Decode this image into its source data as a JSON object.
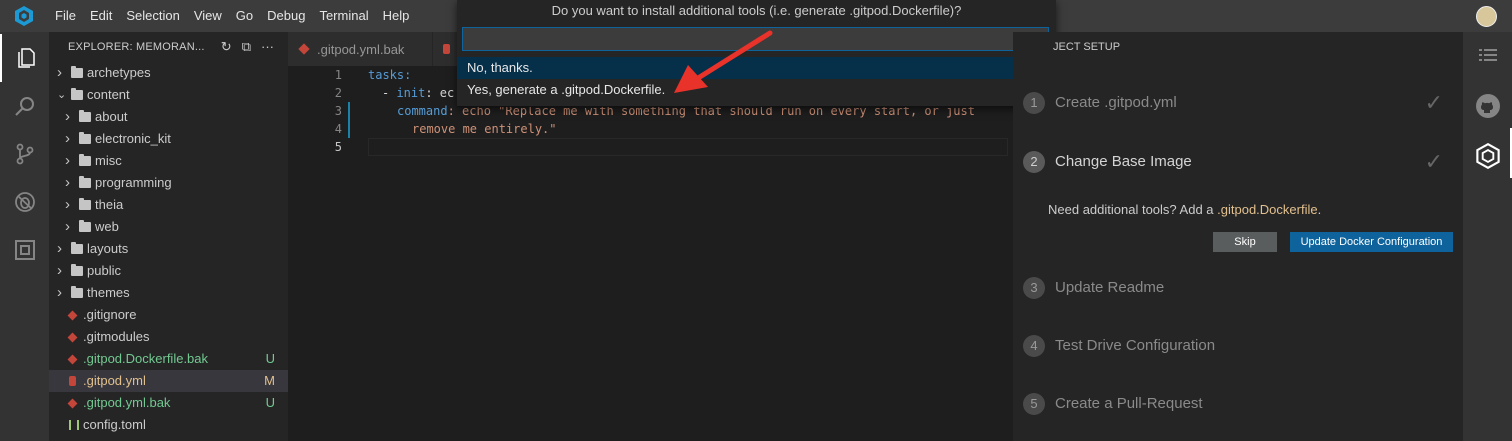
{
  "menubar": {
    "items": [
      "File",
      "Edit",
      "Selection",
      "View",
      "Go",
      "Debug",
      "Terminal",
      "Help"
    ]
  },
  "explorer": {
    "title": "EXPLORER: MEMORAN...",
    "tree": [
      {
        "label": "archetypes",
        "type": "folder",
        "expanded": false,
        "depth": 0
      },
      {
        "label": "content",
        "type": "folder",
        "expanded": true,
        "depth": 0
      },
      {
        "label": "about",
        "type": "folder",
        "expanded": false,
        "depth": 1
      },
      {
        "label": "electronic_kit",
        "type": "folder",
        "expanded": false,
        "depth": 1
      },
      {
        "label": "misc",
        "type": "folder",
        "expanded": false,
        "depth": 1
      },
      {
        "label": "programming",
        "type": "folder",
        "expanded": false,
        "depth": 1
      },
      {
        "label": "theia",
        "type": "folder",
        "expanded": false,
        "depth": 1
      },
      {
        "label": "web",
        "type": "folder",
        "expanded": false,
        "depth": 1
      },
      {
        "label": "layouts",
        "type": "folder",
        "expanded": false,
        "depth": 0
      },
      {
        "label": "public",
        "type": "folder",
        "expanded": false,
        "depth": 0
      },
      {
        "label": "themes",
        "type": "folder",
        "expanded": false,
        "depth": 0
      },
      {
        "label": ".gitignore",
        "type": "git",
        "depth": 0,
        "badge": ""
      },
      {
        "label": ".gitmodules",
        "type": "git",
        "depth": 0,
        "badge": ""
      },
      {
        "label": ".gitpod.Dockerfile.bak",
        "type": "git",
        "depth": 0,
        "badge": "U"
      },
      {
        "label": ".gitpod.yml",
        "type": "db",
        "depth": 0,
        "badge": "M",
        "selected": true
      },
      {
        "label": ".gitpod.yml.bak",
        "type": "git",
        "depth": 0,
        "badge": "U"
      },
      {
        "label": "config.toml",
        "type": "toml",
        "depth": 0,
        "badge": ""
      }
    ]
  },
  "editor": {
    "tab_label": ".gitpod.yml.bak",
    "line_numbers": [
      "1",
      "2",
      "3",
      "4",
      "5"
    ],
    "lines": {
      "l1_key": "tasks:",
      "l2_dash": "- ",
      "l2_key": "init",
      "l2_rest": ": ec",
      "l3_key": "command",
      "l3_rest": ": echo \"Replace me with something that should run on every start, or just",
      "l4_text": "remove me entirely.\""
    }
  },
  "quickpick": {
    "title": "Do you want to install additional tools (i.e. generate .gitpod.Dockerfile)?",
    "input_value": "",
    "options": [
      "No, thanks.",
      "Yes, generate a .gitpod.Dockerfile."
    ]
  },
  "setup_panel": {
    "title": "JECT SETUP",
    "steps": [
      {
        "num": "1",
        "label": "Create .gitpod.yml",
        "done": true
      },
      {
        "num": "2",
        "label": "Change Base Image",
        "done": true
      },
      {
        "num": "3",
        "label": "Update Readme",
        "done": false
      },
      {
        "num": "4",
        "label": "Test Drive Configuration",
        "done": false
      },
      {
        "num": "5",
        "label": "Create a Pull-Request",
        "done": false
      }
    ],
    "prompt_text": "Need additional tools? Add a ",
    "prompt_highlight": ".gitpod.Dockerfile",
    "prompt_end": ".",
    "skip_label": "Skip",
    "update_label": "Update Docker Configuration"
  },
  "colors": {
    "accent": "#0e639c",
    "arrow": "#e8322a",
    "modified": "#e2c08d",
    "untracked": "#73c991"
  }
}
